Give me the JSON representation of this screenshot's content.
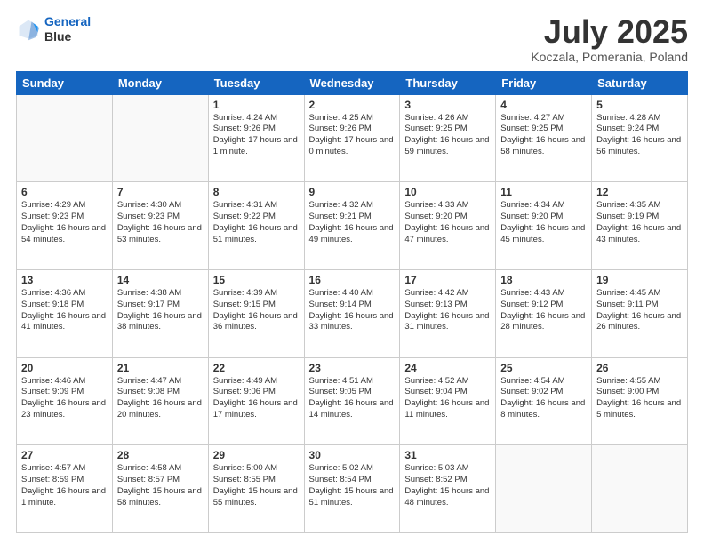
{
  "header": {
    "logo_line1": "General",
    "logo_line2": "Blue",
    "month": "July 2025",
    "location": "Koczala, Pomerania, Poland"
  },
  "days_of_week": [
    "Sunday",
    "Monday",
    "Tuesday",
    "Wednesday",
    "Thursday",
    "Friday",
    "Saturday"
  ],
  "weeks": [
    [
      {
        "day": "",
        "text": ""
      },
      {
        "day": "",
        "text": ""
      },
      {
        "day": "1",
        "text": "Sunrise: 4:24 AM\nSunset: 9:26 PM\nDaylight: 17 hours\nand 1 minute."
      },
      {
        "day": "2",
        "text": "Sunrise: 4:25 AM\nSunset: 9:26 PM\nDaylight: 17 hours\nand 0 minutes."
      },
      {
        "day": "3",
        "text": "Sunrise: 4:26 AM\nSunset: 9:25 PM\nDaylight: 16 hours\nand 59 minutes."
      },
      {
        "day": "4",
        "text": "Sunrise: 4:27 AM\nSunset: 9:25 PM\nDaylight: 16 hours\nand 58 minutes."
      },
      {
        "day": "5",
        "text": "Sunrise: 4:28 AM\nSunset: 9:24 PM\nDaylight: 16 hours\nand 56 minutes."
      }
    ],
    [
      {
        "day": "6",
        "text": "Sunrise: 4:29 AM\nSunset: 9:23 PM\nDaylight: 16 hours\nand 54 minutes."
      },
      {
        "day": "7",
        "text": "Sunrise: 4:30 AM\nSunset: 9:23 PM\nDaylight: 16 hours\nand 53 minutes."
      },
      {
        "day": "8",
        "text": "Sunrise: 4:31 AM\nSunset: 9:22 PM\nDaylight: 16 hours\nand 51 minutes."
      },
      {
        "day": "9",
        "text": "Sunrise: 4:32 AM\nSunset: 9:21 PM\nDaylight: 16 hours\nand 49 minutes."
      },
      {
        "day": "10",
        "text": "Sunrise: 4:33 AM\nSunset: 9:20 PM\nDaylight: 16 hours\nand 47 minutes."
      },
      {
        "day": "11",
        "text": "Sunrise: 4:34 AM\nSunset: 9:20 PM\nDaylight: 16 hours\nand 45 minutes."
      },
      {
        "day": "12",
        "text": "Sunrise: 4:35 AM\nSunset: 9:19 PM\nDaylight: 16 hours\nand 43 minutes."
      }
    ],
    [
      {
        "day": "13",
        "text": "Sunrise: 4:36 AM\nSunset: 9:18 PM\nDaylight: 16 hours\nand 41 minutes."
      },
      {
        "day": "14",
        "text": "Sunrise: 4:38 AM\nSunset: 9:17 PM\nDaylight: 16 hours\nand 38 minutes."
      },
      {
        "day": "15",
        "text": "Sunrise: 4:39 AM\nSunset: 9:15 PM\nDaylight: 16 hours\nand 36 minutes."
      },
      {
        "day": "16",
        "text": "Sunrise: 4:40 AM\nSunset: 9:14 PM\nDaylight: 16 hours\nand 33 minutes."
      },
      {
        "day": "17",
        "text": "Sunrise: 4:42 AM\nSunset: 9:13 PM\nDaylight: 16 hours\nand 31 minutes."
      },
      {
        "day": "18",
        "text": "Sunrise: 4:43 AM\nSunset: 9:12 PM\nDaylight: 16 hours\nand 28 minutes."
      },
      {
        "day": "19",
        "text": "Sunrise: 4:45 AM\nSunset: 9:11 PM\nDaylight: 16 hours\nand 26 minutes."
      }
    ],
    [
      {
        "day": "20",
        "text": "Sunrise: 4:46 AM\nSunset: 9:09 PM\nDaylight: 16 hours\nand 23 minutes."
      },
      {
        "day": "21",
        "text": "Sunrise: 4:47 AM\nSunset: 9:08 PM\nDaylight: 16 hours\nand 20 minutes."
      },
      {
        "day": "22",
        "text": "Sunrise: 4:49 AM\nSunset: 9:06 PM\nDaylight: 16 hours\nand 17 minutes."
      },
      {
        "day": "23",
        "text": "Sunrise: 4:51 AM\nSunset: 9:05 PM\nDaylight: 16 hours\nand 14 minutes."
      },
      {
        "day": "24",
        "text": "Sunrise: 4:52 AM\nSunset: 9:04 PM\nDaylight: 16 hours\nand 11 minutes."
      },
      {
        "day": "25",
        "text": "Sunrise: 4:54 AM\nSunset: 9:02 PM\nDaylight: 16 hours\nand 8 minutes."
      },
      {
        "day": "26",
        "text": "Sunrise: 4:55 AM\nSunset: 9:00 PM\nDaylight: 16 hours\nand 5 minutes."
      }
    ],
    [
      {
        "day": "27",
        "text": "Sunrise: 4:57 AM\nSunset: 8:59 PM\nDaylight: 16 hours\nand 1 minute."
      },
      {
        "day": "28",
        "text": "Sunrise: 4:58 AM\nSunset: 8:57 PM\nDaylight: 15 hours\nand 58 minutes."
      },
      {
        "day": "29",
        "text": "Sunrise: 5:00 AM\nSunset: 8:55 PM\nDaylight: 15 hours\nand 55 minutes."
      },
      {
        "day": "30",
        "text": "Sunrise: 5:02 AM\nSunset: 8:54 PM\nDaylight: 15 hours\nand 51 minutes."
      },
      {
        "day": "31",
        "text": "Sunrise: 5:03 AM\nSunset: 8:52 PM\nDaylight: 15 hours\nand 48 minutes."
      },
      {
        "day": "",
        "text": ""
      },
      {
        "day": "",
        "text": ""
      }
    ]
  ]
}
